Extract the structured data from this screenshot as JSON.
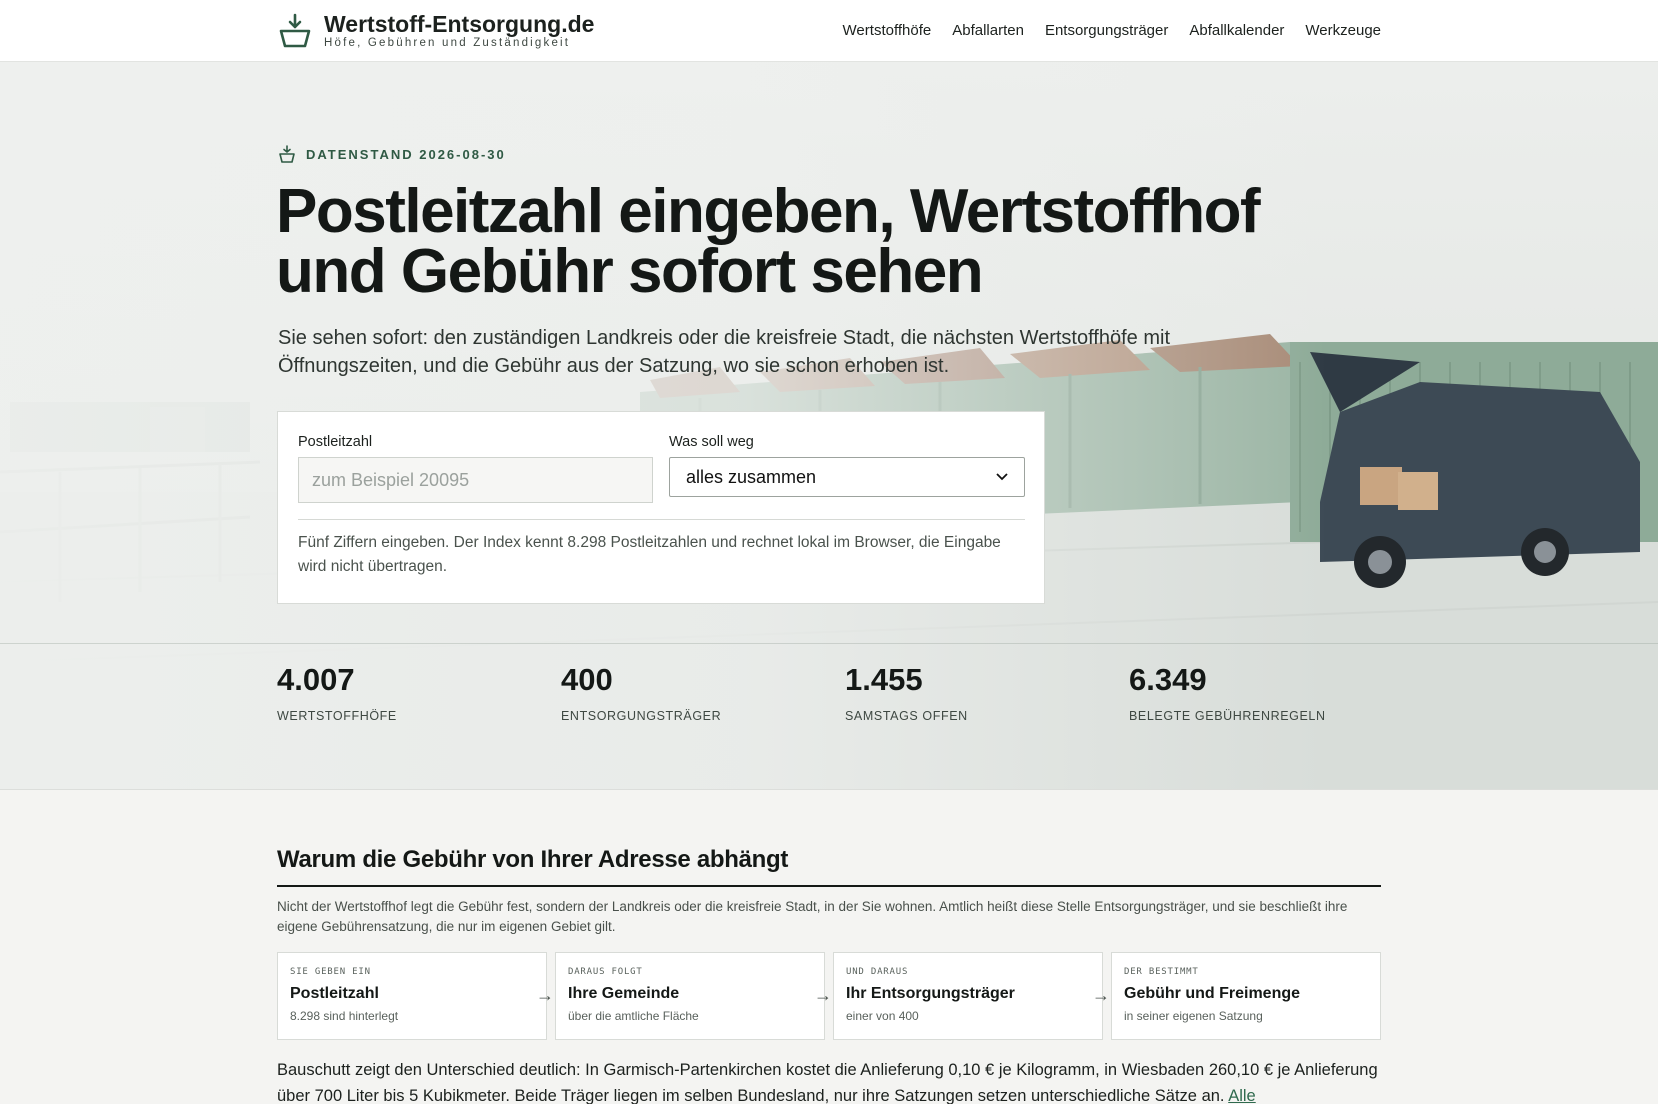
{
  "header": {
    "site_title": "Wertstoff-Entsorgung.de",
    "site_subtitle": "Höfe, Gebühren und Zuständigkeit",
    "logo_icon": "basket-icon",
    "nav": [
      "Wertstoffhöfe",
      "Abfallarten",
      "Entsorgungsträger",
      "Abfallkalender",
      "Werkzeuge"
    ]
  },
  "hero": {
    "kicker": "DATENSTAND 2026-08-30",
    "title": "Postleitzahl eingeben, Wertstoffhof und Gebühr sofort sehen",
    "lead": "Sie sehen sofort: den zuständigen Landkreis oder die kreisfreie Stadt, die nächsten Wertstoffhöfe mit Öffnungszeiten, und die Gebühr aus der Satzung, wo sie schon erhoben ist."
  },
  "search": {
    "zip_label": "Postleitzahl",
    "zip_placeholder": "zum Beispiel 20095",
    "zip_value": "",
    "what_label": "Was soll weg",
    "what_value": "alles zusammen",
    "help": "Fünf Ziffern eingeben. Der Index kennt 8.298 Postleitzahlen und rechnet lokal im Browser, die Eingabe wird nicht übertragen."
  },
  "stats": [
    {
      "value": "4.007",
      "label": "WERTSTOFFHÖFE"
    },
    {
      "value": "400",
      "label": "ENTSORGUNGSTRÄGER"
    },
    {
      "value": "1.455",
      "label": "SAMSTAGS OFFEN"
    },
    {
      "value": "6.349",
      "label": "BELEGTE GEBÜHRENREGELN"
    }
  ],
  "section": {
    "title": "Warum die Gebühr von Ihrer Adresse abhängt",
    "intro": "Nicht der Wertstoffhof legt die Gebühr fest, sondern der Landkreis oder die kreisfreie Stadt, in der Sie wohnen. Amtlich heißt diese Stelle Entsorgungsträger, und sie beschließt ihre eigene Gebührensatzung, die nur im eigenen Gebiet gilt.",
    "steps": [
      {
        "kicker": "SIE GEBEN EIN",
        "title": "Postleitzahl",
        "sub": "8.298 sind hinterlegt"
      },
      {
        "kicker": "DARAUS FOLGT",
        "title": "Ihre Gemeinde",
        "sub": "über die amtliche Fläche"
      },
      {
        "kicker": "UND DARAUS",
        "title": "Ihr Entsorgungsträger",
        "sub": "einer von 400"
      },
      {
        "kicker": "DER BESTIMMT",
        "title": "Gebühr und Freimenge",
        "sub": "in seiner eigenen Satzung"
      }
    ],
    "arrow": "→",
    "body": "Bauschutt zeigt den Unterschied deutlich: In Garmisch-Partenkirchen kostet die Anlieferung 0,10 € je Kilogramm, in Wiesbaden 260,10 € je Anlieferung über 700 Liter bis 5 Kubikmeter. Beide Träger liegen im selben Bundesland, nur ihre Satzungen setzen unterschiedliche Sätze an.",
    "body_link": "Alle"
  },
  "colors": {
    "accent": "#2f5a44",
    "text": "#141816",
    "background": "#f4f4f2"
  }
}
